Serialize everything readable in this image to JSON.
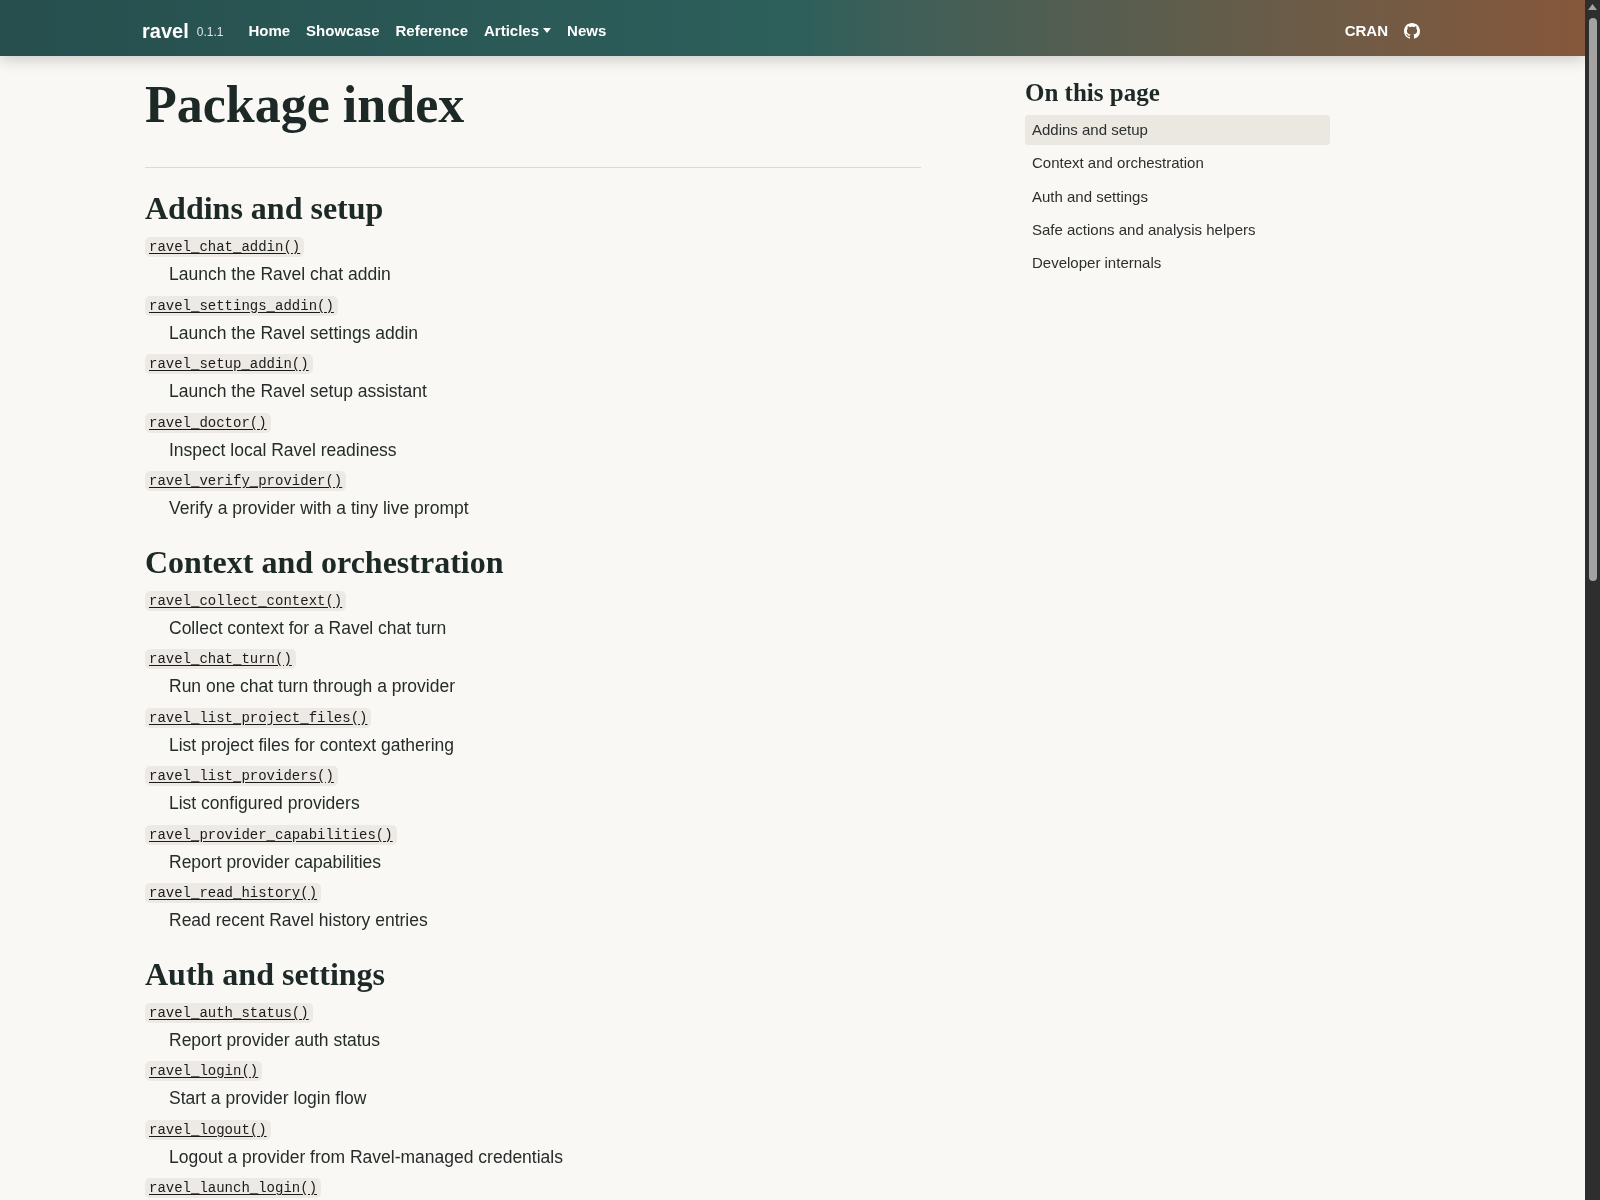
{
  "navbar": {
    "brand": "ravel",
    "version": "0.1.1",
    "links": [
      {
        "label": "Home",
        "dropdown": false
      },
      {
        "label": "Showcase",
        "dropdown": false
      },
      {
        "label": "Reference",
        "dropdown": false
      },
      {
        "label": "Articles",
        "dropdown": true
      },
      {
        "label": "News",
        "dropdown": false
      }
    ],
    "right_links": [
      {
        "label": "CRAN"
      }
    ]
  },
  "page": {
    "title": "Package index",
    "sections": [
      {
        "title": "Addins and setup",
        "items": [
          {
            "name": "ravel_chat_addin()",
            "description": "Launch the Ravel chat addin"
          },
          {
            "name": "ravel_settings_addin()",
            "description": "Launch the Ravel settings addin"
          },
          {
            "name": "ravel_setup_addin()",
            "description": "Launch the Ravel setup assistant"
          },
          {
            "name": "ravel_doctor()",
            "description": "Inspect local Ravel readiness"
          },
          {
            "name": "ravel_verify_provider()",
            "description": "Verify a provider with a tiny live prompt"
          }
        ]
      },
      {
        "title": "Context and orchestration",
        "items": [
          {
            "name": "ravel_collect_context()",
            "description": "Collect context for a Ravel chat turn"
          },
          {
            "name": "ravel_chat_turn()",
            "description": "Run one chat turn through a provider"
          },
          {
            "name": "ravel_list_project_files()",
            "description": "List project files for context gathering"
          },
          {
            "name": "ravel_list_providers()",
            "description": "List configured providers"
          },
          {
            "name": "ravel_provider_capabilities()",
            "description": "Report provider capabilities"
          },
          {
            "name": "ravel_read_history()",
            "description": "Read recent Ravel history entries"
          }
        ]
      },
      {
        "title": "Auth and settings",
        "items": [
          {
            "name": "ravel_auth_status()",
            "description": "Report provider auth status"
          },
          {
            "name": "ravel_login()",
            "description": "Start a provider login flow"
          },
          {
            "name": "ravel_logout()",
            "description": "Logout a provider from Ravel-managed credentials"
          },
          {
            "name": "ravel_launch_login()"
          }
        ]
      }
    ]
  },
  "toc": {
    "title": "On this page",
    "items": [
      {
        "label": "Addins and setup",
        "selected": true
      },
      {
        "label": "Context and orchestration",
        "selected": false
      },
      {
        "label": "Auth and settings",
        "selected": false
      },
      {
        "label": "Safe actions and analysis helpers",
        "selected": false
      },
      {
        "label": "Developer internals",
        "selected": false
      }
    ]
  }
}
